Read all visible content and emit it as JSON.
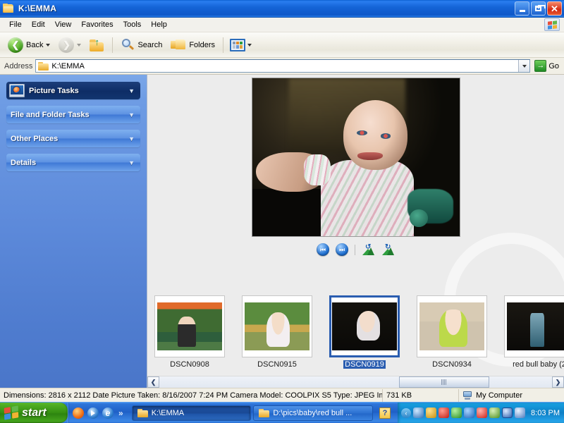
{
  "window": {
    "title": "K:\\EMMA",
    "controls": {
      "minimize": "Minimize",
      "restore": "Restore",
      "close": "Close"
    }
  },
  "menubar": {
    "items": [
      {
        "label": "File"
      },
      {
        "label": "Edit"
      },
      {
        "label": "View"
      },
      {
        "label": "Favorites"
      },
      {
        "label": "Tools"
      },
      {
        "label": "Help"
      }
    ]
  },
  "toolbar": {
    "back_label": "Back",
    "forward_label": "Forward",
    "up_label": "Up",
    "search_label": "Search",
    "folders_label": "Folders",
    "views_label": "Views"
  },
  "address": {
    "label": "Address",
    "value": "K:\\EMMA",
    "go_label": "Go",
    "go_glyph": "→"
  },
  "sidebar": {
    "panels": [
      {
        "title": "Picture Tasks",
        "style": "dark",
        "icon": "picture-tasks-icon"
      },
      {
        "title": "File and Folder Tasks",
        "style": "light",
        "icon": ""
      },
      {
        "title": "Other Places",
        "style": "light",
        "icon": ""
      },
      {
        "title": "Details",
        "style": "light",
        "icon": ""
      }
    ],
    "expand_glyph": "˅"
  },
  "preview": {
    "alt": "DSCN0919 - baby photo",
    "controls": {
      "previous_label": "Previous Image",
      "previous_glyph": "⏮",
      "next_label": "Next Image",
      "next_glyph": "⏭",
      "rotate_ccw_label": "Rotate Counterclockwise",
      "rotate_cw_label": "Rotate Clockwise"
    }
  },
  "filmstrip": {
    "thumbnails": [
      {
        "label": "DSCN0908",
        "selected": false,
        "art": "t1"
      },
      {
        "label": "DSCN0915",
        "selected": false,
        "art": "t2"
      },
      {
        "label": "DSCN0919",
        "selected": true,
        "art": "t3"
      },
      {
        "label": "DSCN0934",
        "selected": false,
        "art": "t4"
      },
      {
        "label": "red bull baby (2",
        "selected": false,
        "art": "t5"
      }
    ],
    "scrollbar": {
      "left_glyph": "❮",
      "right_glyph": "❯"
    }
  },
  "statusbar": {
    "details": "Dimensions: 2816 x 2112 Date Picture Taken: 8/16/2007 7:24 PM Camera Model: COOLPIX S5 Type: JPEG Image Size",
    "size": "731 KB",
    "location": "My Computer"
  },
  "taskbar": {
    "start_label": "start",
    "quicklaunch_overflow": "»",
    "tasks": [
      {
        "label": "K:\\EMMA",
        "active": true
      },
      {
        "label": "D:\\pics\\baby\\red bull ...",
        "active": false
      }
    ],
    "notes_glyph": "?",
    "tray_chevron": "‹",
    "clock": "8:03 PM"
  },
  "colors": {
    "titlebar_blue": "#1565d8",
    "sidebar_blue": "#5b88d8",
    "selection_blue": "#2a5db0",
    "content_gray": "#ececec",
    "start_green": "#359012",
    "close_red": "#d42a12"
  }
}
